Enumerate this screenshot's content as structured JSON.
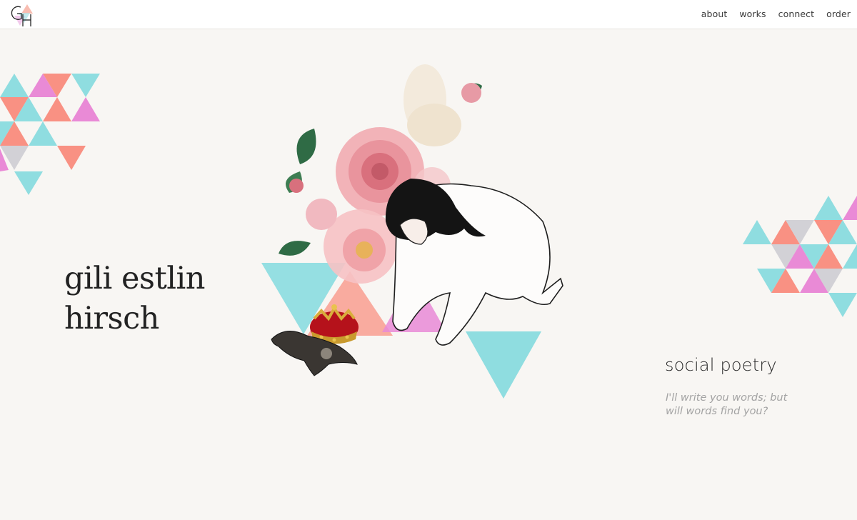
{
  "header": {
    "logo_icon": "gh-monogram-icon",
    "nav": [
      {
        "label": "about"
      },
      {
        "label": "works"
      },
      {
        "label": "connect"
      },
      {
        "label": "order"
      }
    ]
  },
  "hero": {
    "name_line1": "gili estlin",
    "name_line2": "hirsch"
  },
  "tagline": {
    "title": "social poetry",
    "quote_line1": "I'll write you words; but",
    "quote_line2": "will words find you?"
  },
  "colors": {
    "background": "#f8f6f3",
    "teal": "#8fdde0",
    "coral": "#f99183",
    "pink": "#e98ad6",
    "grey": "#d2d1d6",
    "crown_red": "#b5121b"
  },
  "illustration": {
    "icons": [
      "floral-bouquet-icon",
      "crouching-figure-icon",
      "crown-icon",
      "bat-icon",
      "triangle-pattern-icon"
    ]
  }
}
